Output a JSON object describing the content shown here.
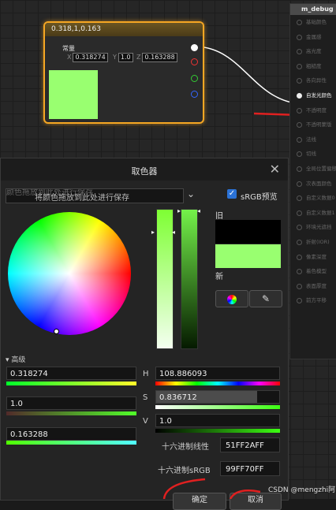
{
  "graph": {
    "const_node": {
      "title": "0.318,1,0.163",
      "label": "常量",
      "x_axis": "X",
      "x_value": "0.318274",
      "y_axis": "Y",
      "y_value": "1.0",
      "z_axis": "Z",
      "z_value": "0.163288",
      "swatch_color": "#99ff70"
    },
    "debug_panel": {
      "title": "m_debug",
      "rows": [
        "基础颜色",
        "金属感",
        "高光度",
        "粗糙度",
        "各向异性",
        "自发光颜色",
        "不透明度",
        "不透明蒙版",
        "法线",
        "切线",
        "全局位置偏移",
        "次表面颜色",
        "自定义数据0",
        "自定义数据1",
        "环境光遮挡",
        "折射(IOR)",
        "像素深度",
        "着色模型",
        "表面厚度",
        "前方平移"
      ],
      "highlight_index": 5
    }
  },
  "picker": {
    "title": "取色器",
    "hint_ghost": "颜色拖放到此处进行保存",
    "hint_text": "将颜色拖放到此处进行保存",
    "srgb_label": "sRGB预览",
    "old_label": "旧",
    "new_label": "新",
    "advanced_label": "高级",
    "r_value": "0.318274",
    "g_value": "1.0",
    "b_value": "0.163288",
    "h_label": "H",
    "h_value": "108.886093",
    "s_label": "S",
    "s_value": "0.836712",
    "v_label": "V",
    "v_value": "1.0",
    "hex_linear_label": "十六进制线性",
    "hex_linear_value": "51FF2AFF",
    "hex_srgb_label": "十六进制sRGB",
    "hex_srgb_value": "99FF70FF",
    "ok_label": "确定",
    "cancel_label": "取消",
    "new_color": "#99ff70",
    "old_color": "#000000"
  },
  "watermark": "CSDN @mengzhi阿"
}
